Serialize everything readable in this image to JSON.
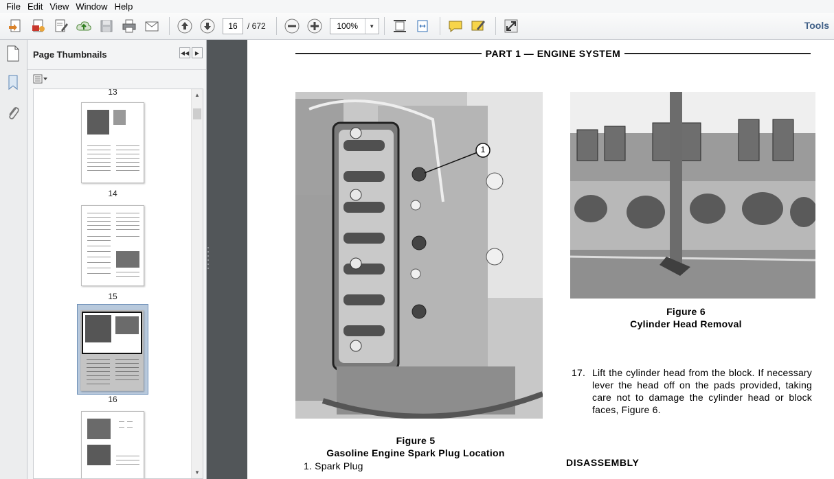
{
  "menu": [
    "File",
    "Edit",
    "View",
    "Window",
    "Help"
  ],
  "toolbar": {
    "current_page": "16",
    "page_total": "/ 672",
    "zoom": "100%",
    "tools_label": "Tools"
  },
  "sidebar": {
    "title": "Page Thumbnails",
    "thumbnails": [
      {
        "page": "13"
      },
      {
        "page": "14"
      },
      {
        "page": "15"
      },
      {
        "page": "16",
        "selected": true
      }
    ]
  },
  "document": {
    "header": "PART 1 — ENGINE SYSTEM",
    "figure5": {
      "title": "Figure 5",
      "subtitle": "Gasoline Engine Spark Plug Location",
      "callout": "1",
      "legend": "1.  Spark Plug"
    },
    "figure6": {
      "title": "Figure 6",
      "subtitle": "Cylinder Head Removal"
    },
    "step17": {
      "number": "17.",
      "text": "Lift the cylinder head from the block. If necessary lever the head off on the pads provided, taking care not to damage the cylinder head or block faces, Figure 6."
    },
    "section": "DISASSEMBLY"
  },
  "colors": {
    "doc_background": "#525659",
    "tools_link": "#3f5f87",
    "selected_thumb": "#b8c9dc"
  }
}
